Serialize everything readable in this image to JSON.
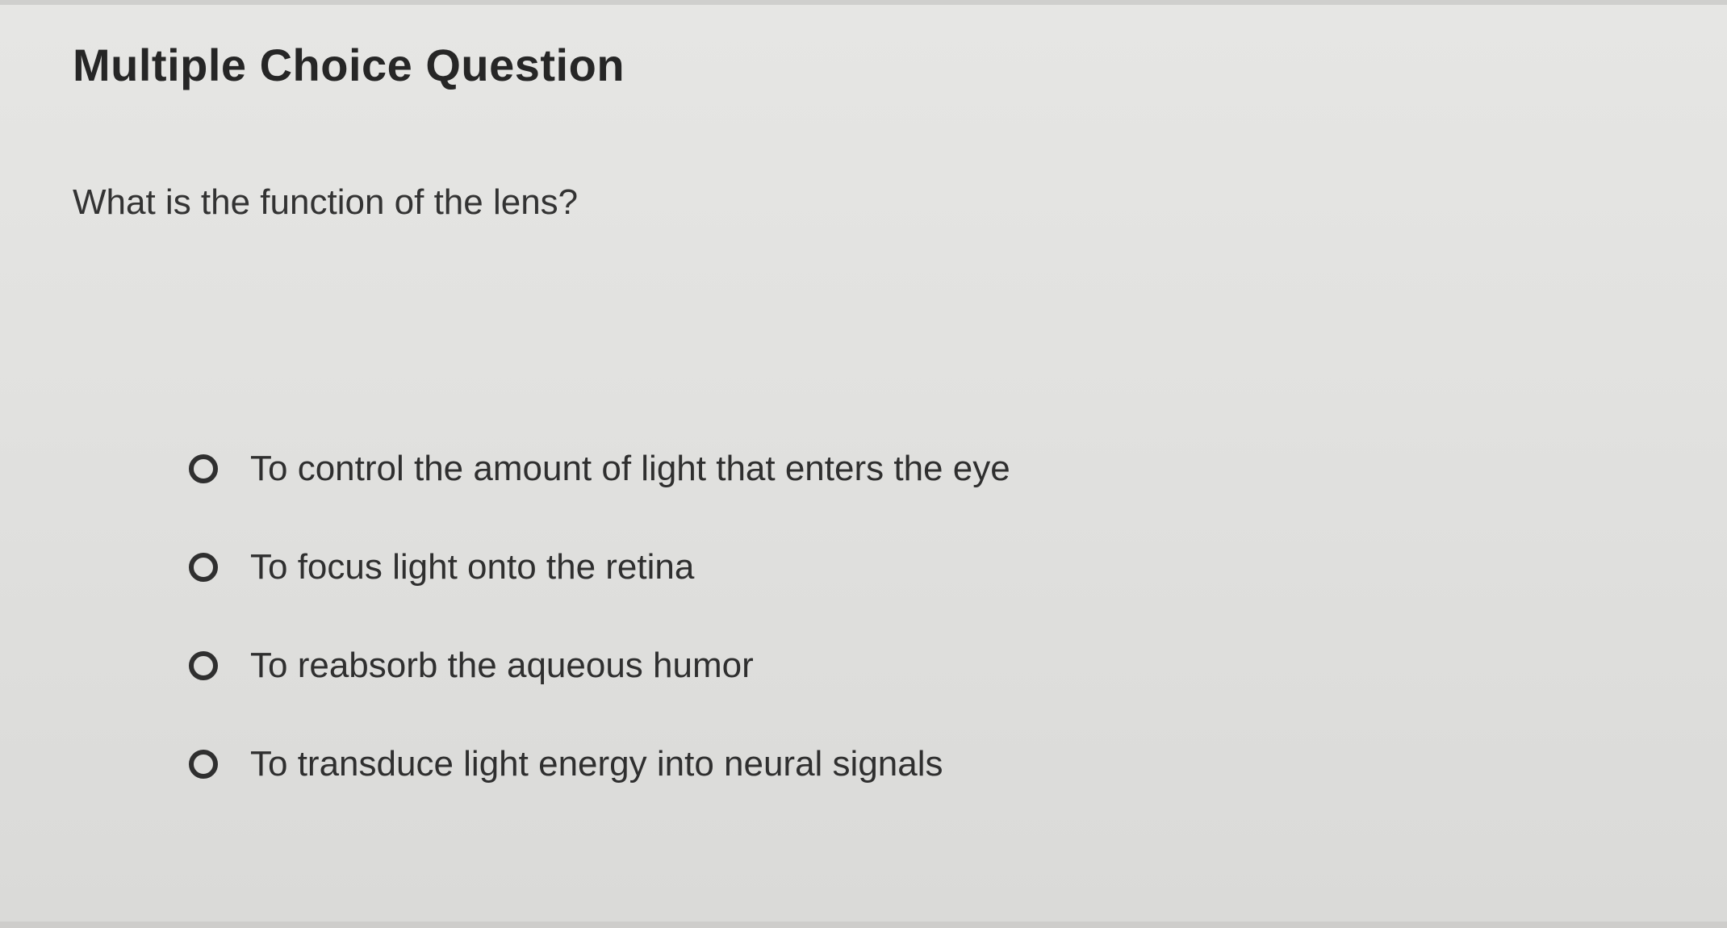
{
  "header": {
    "title": "Multiple Choice Question"
  },
  "question": {
    "text": "What is the function of the lens?"
  },
  "options": [
    {
      "label": "To control the amount of light that enters the eye"
    },
    {
      "label": "To focus light onto the retina"
    },
    {
      "label": "To reabsorb the aqueous humor"
    },
    {
      "label": "To transduce light energy into neural signals"
    }
  ]
}
